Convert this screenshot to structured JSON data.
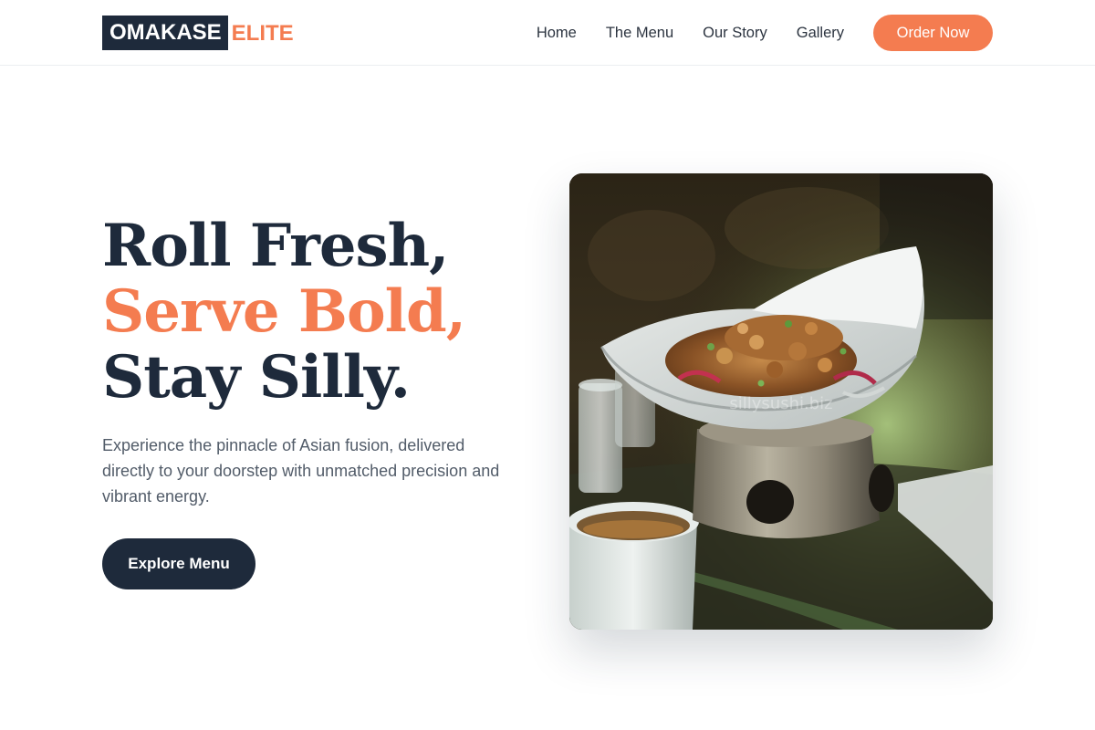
{
  "brand": {
    "main": "OMAKASE",
    "accent": "ELITE",
    "dark_color": "#1e2a3b",
    "accent_color": "#f47c50"
  },
  "nav": {
    "links": [
      {
        "label": "Home"
      },
      {
        "label": "The Menu"
      },
      {
        "label": "Our Story"
      },
      {
        "label": "Gallery"
      }
    ],
    "cta_label": "Order Now"
  },
  "hero": {
    "title_line1": "Roll Fresh,",
    "title_line2": "Serve Bold,",
    "title_line3": "Stay Silly.",
    "description": "Experience the pinnacle of Asian fusion, delivered directly to your doorstep with unmatched precision and vibrant energy.",
    "button_label": "Explore Menu",
    "image_subject": "dish-on-warmer-photo",
    "image_watermark": "sillysushi.biz"
  }
}
